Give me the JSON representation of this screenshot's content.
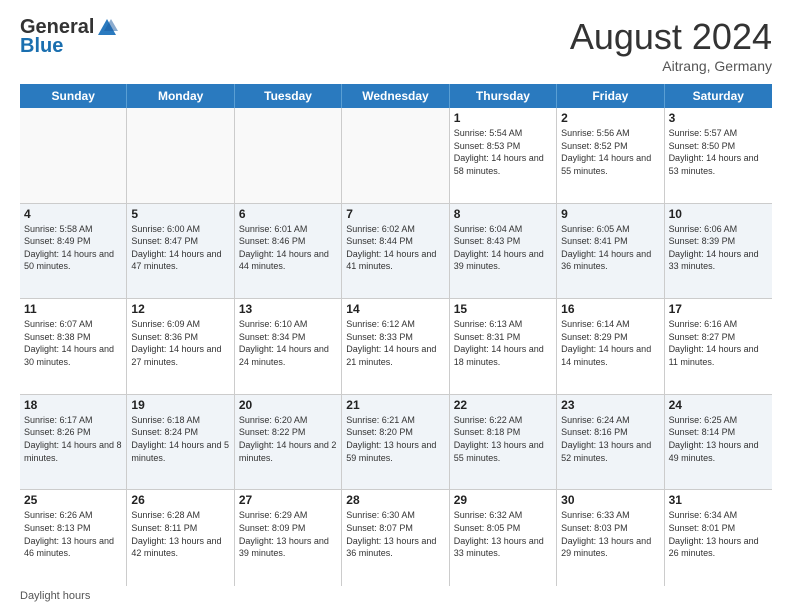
{
  "header": {
    "logo_general": "General",
    "logo_blue": "Blue",
    "month_year": "August 2024",
    "location": "Aitrang, Germany"
  },
  "days_of_week": [
    "Sunday",
    "Monday",
    "Tuesday",
    "Wednesday",
    "Thursday",
    "Friday",
    "Saturday"
  ],
  "weeks": [
    [
      {
        "day": "",
        "empty": true
      },
      {
        "day": "",
        "empty": true
      },
      {
        "day": "",
        "empty": true
      },
      {
        "day": "",
        "empty": true
      },
      {
        "day": "1",
        "sunrise": "Sunrise: 5:54 AM",
        "sunset": "Sunset: 8:53 PM",
        "daylight": "Daylight: 14 hours and 58 minutes."
      },
      {
        "day": "2",
        "sunrise": "Sunrise: 5:56 AM",
        "sunset": "Sunset: 8:52 PM",
        "daylight": "Daylight: 14 hours and 55 minutes."
      },
      {
        "day": "3",
        "sunrise": "Sunrise: 5:57 AM",
        "sunset": "Sunset: 8:50 PM",
        "daylight": "Daylight: 14 hours and 53 minutes."
      }
    ],
    [
      {
        "day": "4",
        "sunrise": "Sunrise: 5:58 AM",
        "sunset": "Sunset: 8:49 PM",
        "daylight": "Daylight: 14 hours and 50 minutes."
      },
      {
        "day": "5",
        "sunrise": "Sunrise: 6:00 AM",
        "sunset": "Sunset: 8:47 PM",
        "daylight": "Daylight: 14 hours and 47 minutes."
      },
      {
        "day": "6",
        "sunrise": "Sunrise: 6:01 AM",
        "sunset": "Sunset: 8:46 PM",
        "daylight": "Daylight: 14 hours and 44 minutes."
      },
      {
        "day": "7",
        "sunrise": "Sunrise: 6:02 AM",
        "sunset": "Sunset: 8:44 PM",
        "daylight": "Daylight: 14 hours and 41 minutes."
      },
      {
        "day": "8",
        "sunrise": "Sunrise: 6:04 AM",
        "sunset": "Sunset: 8:43 PM",
        "daylight": "Daylight: 14 hours and 39 minutes."
      },
      {
        "day": "9",
        "sunrise": "Sunrise: 6:05 AM",
        "sunset": "Sunset: 8:41 PM",
        "daylight": "Daylight: 14 hours and 36 minutes."
      },
      {
        "day": "10",
        "sunrise": "Sunrise: 6:06 AM",
        "sunset": "Sunset: 8:39 PM",
        "daylight": "Daylight: 14 hours and 33 minutes."
      }
    ],
    [
      {
        "day": "11",
        "sunrise": "Sunrise: 6:07 AM",
        "sunset": "Sunset: 8:38 PM",
        "daylight": "Daylight: 14 hours and 30 minutes."
      },
      {
        "day": "12",
        "sunrise": "Sunrise: 6:09 AM",
        "sunset": "Sunset: 8:36 PM",
        "daylight": "Daylight: 14 hours and 27 minutes."
      },
      {
        "day": "13",
        "sunrise": "Sunrise: 6:10 AM",
        "sunset": "Sunset: 8:34 PM",
        "daylight": "Daylight: 14 hours and 24 minutes."
      },
      {
        "day": "14",
        "sunrise": "Sunrise: 6:12 AM",
        "sunset": "Sunset: 8:33 PM",
        "daylight": "Daylight: 14 hours and 21 minutes."
      },
      {
        "day": "15",
        "sunrise": "Sunrise: 6:13 AM",
        "sunset": "Sunset: 8:31 PM",
        "daylight": "Daylight: 14 hours and 18 minutes."
      },
      {
        "day": "16",
        "sunrise": "Sunrise: 6:14 AM",
        "sunset": "Sunset: 8:29 PM",
        "daylight": "Daylight: 14 hours and 14 minutes."
      },
      {
        "day": "17",
        "sunrise": "Sunrise: 6:16 AM",
        "sunset": "Sunset: 8:27 PM",
        "daylight": "Daylight: 14 hours and 11 minutes."
      }
    ],
    [
      {
        "day": "18",
        "sunrise": "Sunrise: 6:17 AM",
        "sunset": "Sunset: 8:26 PM",
        "daylight": "Daylight: 14 hours and 8 minutes."
      },
      {
        "day": "19",
        "sunrise": "Sunrise: 6:18 AM",
        "sunset": "Sunset: 8:24 PM",
        "daylight": "Daylight: 14 hours and 5 minutes."
      },
      {
        "day": "20",
        "sunrise": "Sunrise: 6:20 AM",
        "sunset": "Sunset: 8:22 PM",
        "daylight": "Daylight: 14 hours and 2 minutes."
      },
      {
        "day": "21",
        "sunrise": "Sunrise: 6:21 AM",
        "sunset": "Sunset: 8:20 PM",
        "daylight": "Daylight: 13 hours and 59 minutes."
      },
      {
        "day": "22",
        "sunrise": "Sunrise: 6:22 AM",
        "sunset": "Sunset: 8:18 PM",
        "daylight": "Daylight: 13 hours and 55 minutes."
      },
      {
        "day": "23",
        "sunrise": "Sunrise: 6:24 AM",
        "sunset": "Sunset: 8:16 PM",
        "daylight": "Daylight: 13 hours and 52 minutes."
      },
      {
        "day": "24",
        "sunrise": "Sunrise: 6:25 AM",
        "sunset": "Sunset: 8:14 PM",
        "daylight": "Daylight: 13 hours and 49 minutes."
      }
    ],
    [
      {
        "day": "25",
        "sunrise": "Sunrise: 6:26 AM",
        "sunset": "Sunset: 8:13 PM",
        "daylight": "Daylight: 13 hours and 46 minutes."
      },
      {
        "day": "26",
        "sunrise": "Sunrise: 6:28 AM",
        "sunset": "Sunset: 8:11 PM",
        "daylight": "Daylight: 13 hours and 42 minutes."
      },
      {
        "day": "27",
        "sunrise": "Sunrise: 6:29 AM",
        "sunset": "Sunset: 8:09 PM",
        "daylight": "Daylight: 13 hours and 39 minutes."
      },
      {
        "day": "28",
        "sunrise": "Sunrise: 6:30 AM",
        "sunset": "Sunset: 8:07 PM",
        "daylight": "Daylight: 13 hours and 36 minutes."
      },
      {
        "day": "29",
        "sunrise": "Sunrise: 6:32 AM",
        "sunset": "Sunset: 8:05 PM",
        "daylight": "Daylight: 13 hours and 33 minutes."
      },
      {
        "day": "30",
        "sunrise": "Sunrise: 6:33 AM",
        "sunset": "Sunset: 8:03 PM",
        "daylight": "Daylight: 13 hours and 29 minutes."
      },
      {
        "day": "31",
        "sunrise": "Sunrise: 6:34 AM",
        "sunset": "Sunset: 8:01 PM",
        "daylight": "Daylight: 13 hours and 26 minutes."
      }
    ]
  ],
  "footer": {
    "note": "Daylight hours"
  }
}
